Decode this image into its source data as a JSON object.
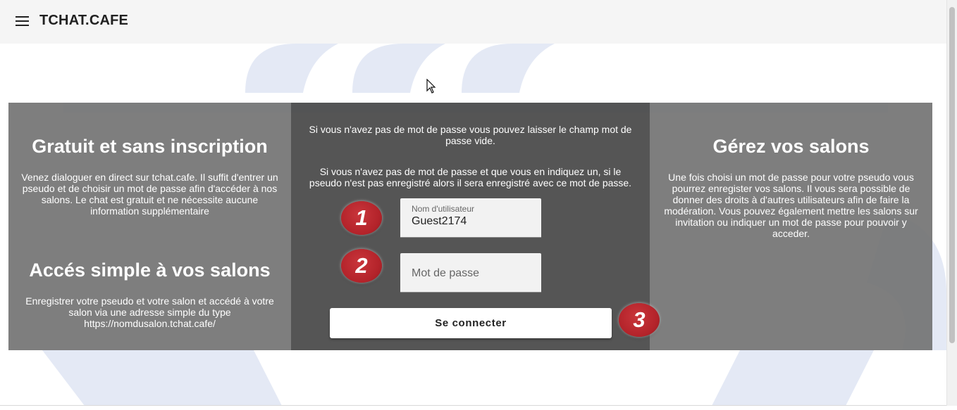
{
  "header": {
    "title": "TCHAT.CAFE",
    "menu_icon": "menu-icon"
  },
  "left_panel": {
    "heading1": "Gratuit et sans inscription",
    "text1": "Venez dialoguer en direct sur tchat.cafe. Il suffit d'entrer un pseudo et de choisir un mot de passe afin d'accéder à nos salons. Le chat est gratuit et ne nécessite aucune information supplémentaire",
    "heading2": "Accés simple à vos salons",
    "text2": "Enregistrer votre pseudo et votre salon et accédé à votre salon via une adresse simple du type https://nomdusalon.tchat.cafe/"
  },
  "login": {
    "info1": "Si vous n'avez pas de mot de passe vous pouvez laisser le champ mot de passe vide.",
    "info2": "Si vous n'avez pas de mot de passe et que vous en indiquez un, si le pseudo n'est pas enregistré alors il sera enregistré avec ce mot de passe.",
    "username_label": "Nom d'utilisateur",
    "username_value": "Guest2174",
    "password_placeholder": "Mot de passe",
    "connect_label": "Se connecter"
  },
  "right_panel": {
    "heading": "Gérez vos salons",
    "text": "Une fois choisi un mot de passe pour votre pseudo vous pourrez enregister vos salons. Il vous sera possible de donner des droits à d'autres utilisateurs afin de faire la modération. Vous pouvez également mettre les salons sur invitation ou indiquer un mot de passe pour pouvoir y acceder."
  },
  "badges": [
    "1",
    "2",
    "3"
  ],
  "colors": {
    "badge": "#b3232a",
    "watermark": "#e4e9f5",
    "topbar": "#f5f5f5"
  }
}
